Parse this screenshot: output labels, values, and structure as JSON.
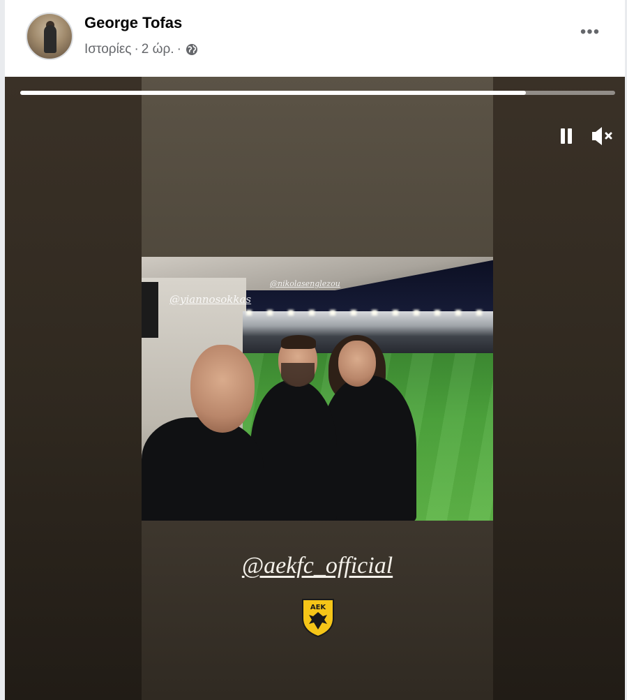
{
  "post": {
    "author": "George Tofas",
    "meta": {
      "section": "Ιστορίες",
      "time": "2 ώρ.",
      "separator": "·",
      "privacy_icon": "globe-icon"
    },
    "more_icon": "more-options-icon",
    "more_label": "•••"
  },
  "story": {
    "progress_fraction": 0.85,
    "controls": {
      "pause_icon": "pause-icon",
      "mute_icon": "muted-speaker-icon"
    },
    "photo_tags": [
      "@yiannosokkas",
      "@nikolasenglezou"
    ],
    "mention": "@aekfc_official",
    "badge": {
      "icon": "aek-club-crest-icon",
      "letters": "ΑΕΚ"
    }
  },
  "colors": {
    "accent_badge": "#f5c518",
    "text_primary": "#050505",
    "text_secondary": "#65676b"
  }
}
